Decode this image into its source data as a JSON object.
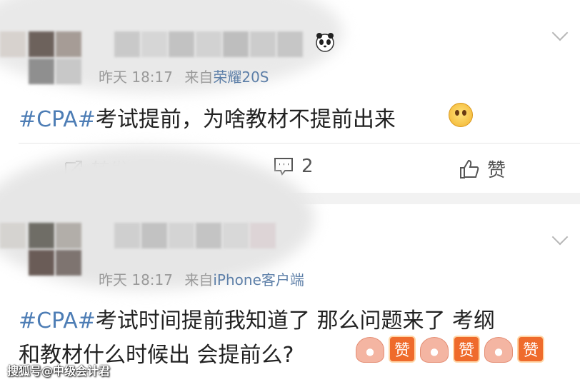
{
  "posts": [
    {
      "meta_time": "昨天 18:17",
      "meta_from": "来自",
      "meta_source": "荣耀20S",
      "hashtag": "#CPA#",
      "text": "考试提前，为啥教材不提前出来",
      "emoji_icon": "worried-face-icon",
      "actions": {
        "repost": "转发",
        "comment": "2",
        "like": "赞"
      }
    },
    {
      "meta_time": "昨天 18:17",
      "meta_from": "来自",
      "meta_source": "iPhone客户端",
      "hashtag": "#CPA#",
      "line1": "考试时间提前我知道了 那么问题来了 考纲",
      "line2": "和教材什么时候出 会提前么?",
      "sticker_label": "赞"
    }
  ],
  "watermark": "搜狐号@中级会计君",
  "colors": {
    "hashtag": "#4d7db5",
    "source": "#5d7fa8",
    "meta": "#9a9a9a",
    "text": "#222222"
  }
}
